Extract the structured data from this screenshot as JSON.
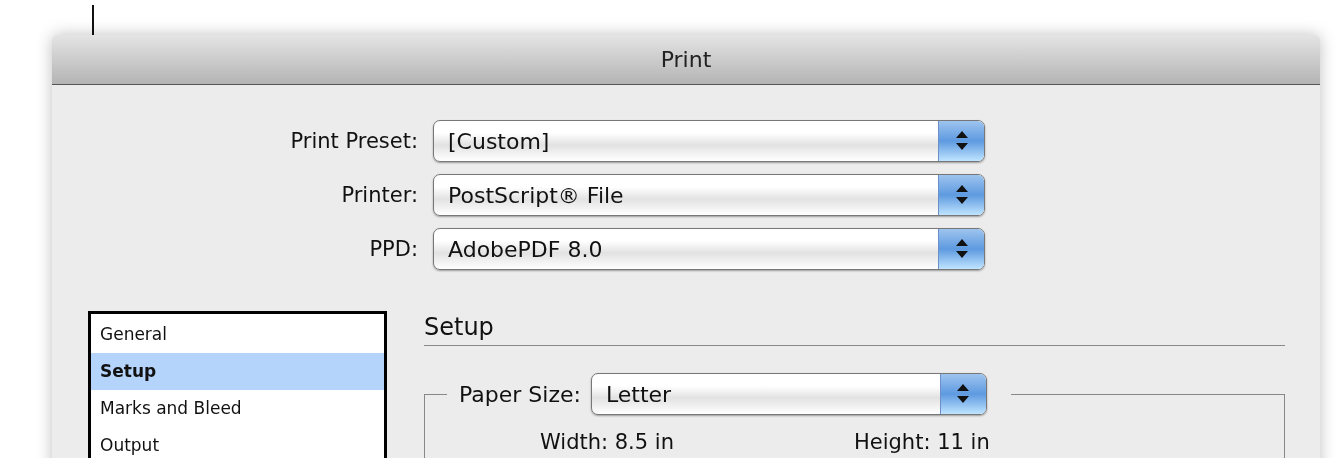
{
  "window": {
    "title": "Print"
  },
  "fields": [
    {
      "label": "Print Preset:",
      "value": "[Custom]"
    },
    {
      "label": "Printer:",
      "value": "PostScript® File"
    },
    {
      "label": "PPD:",
      "value": "AdobePDF 8.0"
    }
  ],
  "categories": [
    {
      "label": "General",
      "selected": false
    },
    {
      "label": "Setup",
      "selected": true
    },
    {
      "label": "Marks and Bleed",
      "selected": false
    },
    {
      "label": "Output",
      "selected": false
    }
  ],
  "section": {
    "title": "Setup",
    "paper_size": {
      "label": "Paper Size:",
      "value": "Letter"
    },
    "width": "Width: 8.5 in",
    "height": "Height: 11 in"
  }
}
